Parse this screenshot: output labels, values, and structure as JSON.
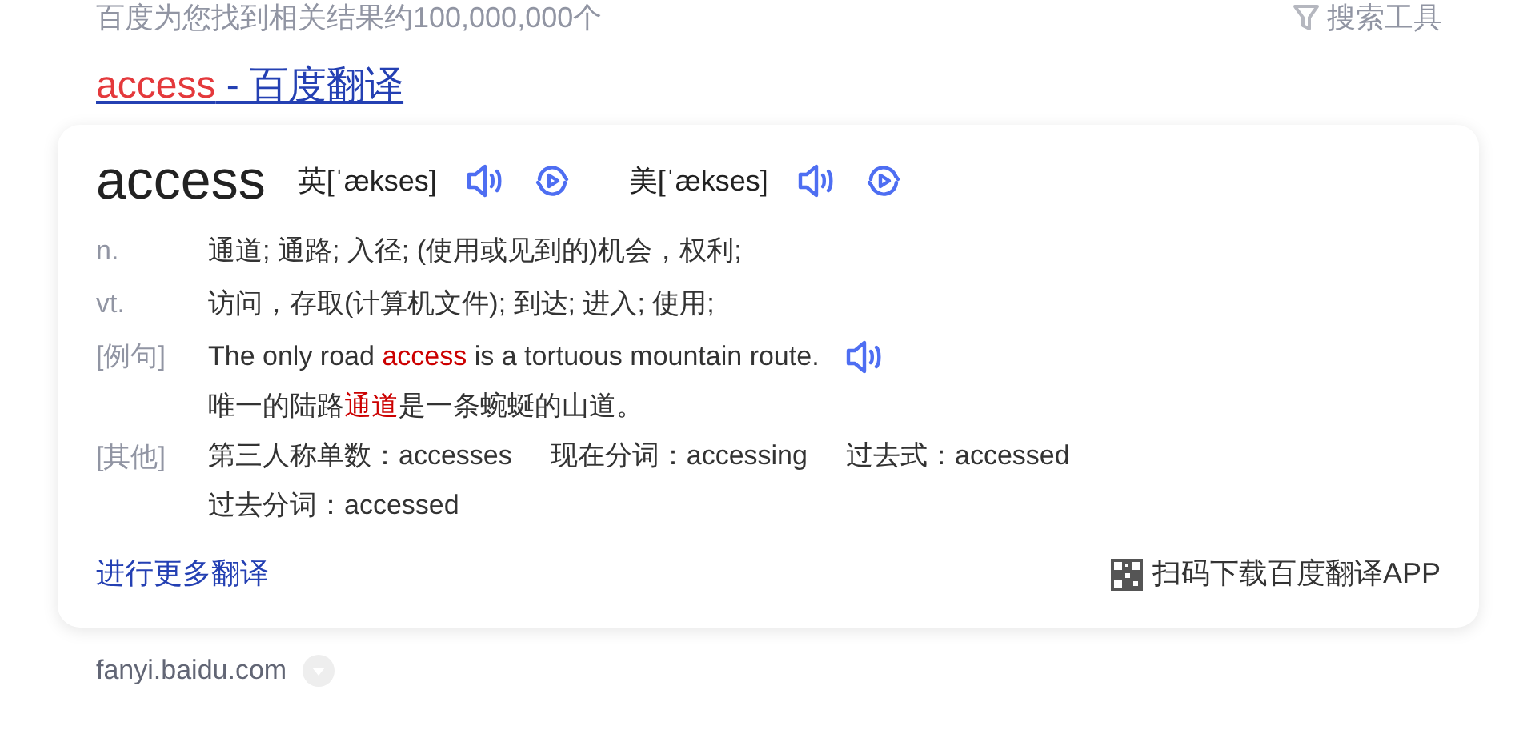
{
  "result_count": "百度为您找到相关结果约100,000,000个",
  "search_tools": "搜索工具",
  "title_link": {
    "highlight": "access",
    "rest": " - 百度翻译"
  },
  "card": {
    "word": "access",
    "pronunciations": [
      {
        "label": "英[ˈækses]"
      },
      {
        "label": "美[ˈækses]"
      }
    ],
    "definitions": [
      {
        "pos": "n.",
        "text": "通道; 通路; 入径; (使用或见到的)机会，权利;"
      },
      {
        "pos": "vt.",
        "text": "访问，存取(计算机文件); 到达; 进入; 使用;"
      }
    ],
    "example": {
      "label": "[例句]",
      "sentence": [
        {
          "text": "The only road ",
          "highlight": false
        },
        {
          "text": "access",
          "highlight": true
        },
        {
          "text": " is a tortuous mountain route.",
          "highlight": false
        }
      ],
      "translation": [
        {
          "text": "唯一的陆路",
          "highlight": false
        },
        {
          "text": "通道",
          "highlight": true
        },
        {
          "text": "是一条蜿蜒的山道。",
          "highlight": false
        }
      ]
    },
    "forms": {
      "label": "[其他]",
      "items": [
        "第三人称单数：accesses",
        "现在分词：accessing",
        "过去式：accessed",
        "过去分词：accessed"
      ]
    },
    "more_link": "进行更多翻译",
    "app_link": "扫码下载百度翻译APP"
  },
  "source_url": "fanyi.baidu.com"
}
